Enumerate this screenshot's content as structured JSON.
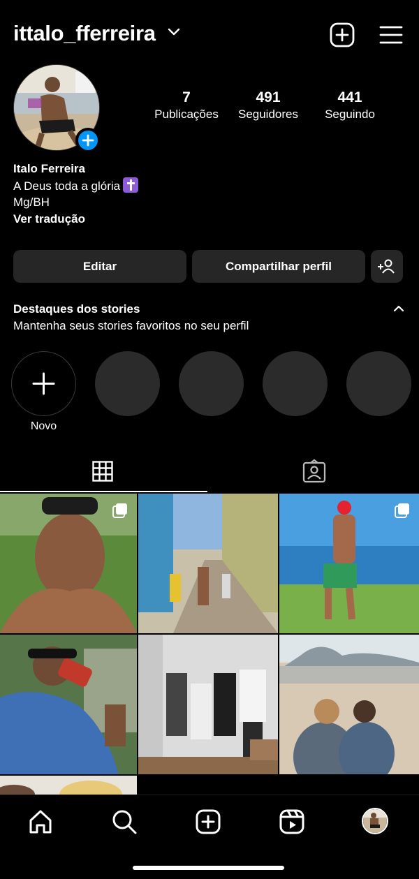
{
  "header": {
    "username": "ittalo_fferreira",
    "icons": [
      "chevron-down-icon",
      "create-plus-icon",
      "menu-icon"
    ]
  },
  "profile": {
    "stats": [
      {
        "value": "7",
        "label": "Publicações"
      },
      {
        "value": "491",
        "label": "Seguidores"
      },
      {
        "value": "441",
        "label": "Seguindo"
      }
    ],
    "name": "Italo Ferreira",
    "bio_line1": "A Deus toda a glória",
    "bio_line2": "Mg/BH",
    "translate": "Ver tradução"
  },
  "actions": {
    "edit": "Editar",
    "share": "Compartilhar perfil"
  },
  "highlights": {
    "title": "Destaques dos stories",
    "subtitle": "Mantenha seus stories favoritos no seu perfil",
    "new_label": "Novo"
  },
  "tabs": [
    "grid-icon",
    "tagged-icon"
  ],
  "bottom_nav": [
    "home-icon",
    "search-icon",
    "create-icon",
    "reels-icon",
    "profile-avatar"
  ],
  "colors": {
    "background": "#000000",
    "button": "#262626",
    "accent": "#0095f6"
  }
}
